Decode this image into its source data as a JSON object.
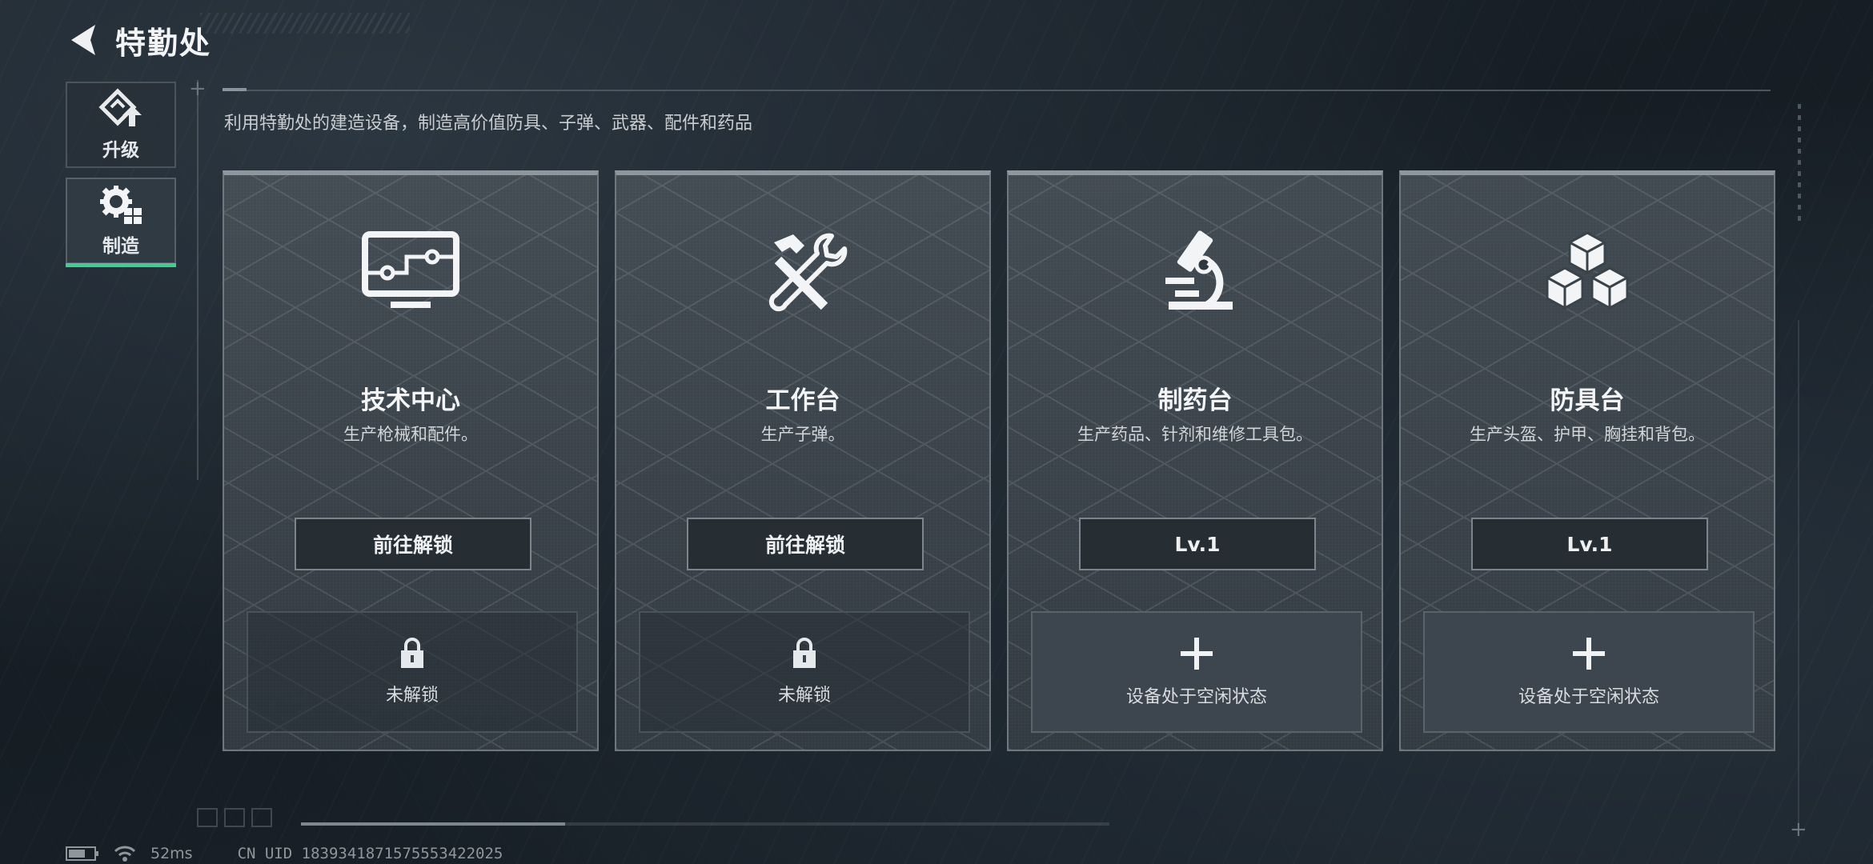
{
  "header": {
    "title": "特勤处"
  },
  "sidebar": {
    "items": [
      {
        "label": "升级",
        "icon": "upgrade-icon",
        "active": false
      },
      {
        "label": "制造",
        "icon": "gear-icon",
        "active": true
      }
    ]
  },
  "main": {
    "description": "利用特勤处的建造设备，制造高价值防具、子弹、武器、配件和药品",
    "cards": [
      {
        "icon": "computer-icon",
        "title": "技术中心",
        "subtitle": "生产枪械和配件。",
        "button_label": "前往解锁",
        "slot_icon": "lock-icon",
        "slot_text": "未解锁"
      },
      {
        "icon": "hammer-wrench-icon",
        "title": "工作台",
        "subtitle": "生产子弹。",
        "button_label": "前往解锁",
        "slot_icon": "lock-icon",
        "slot_text": "未解锁"
      },
      {
        "icon": "microscope-icon",
        "title": "制药台",
        "subtitle": "生产药品、针剂和维修工具包。",
        "button_label": "Lv.1",
        "slot_icon": "plus-icon",
        "slot_text": "设备处于空闲状态"
      },
      {
        "icon": "cubes-icon",
        "title": "防具台",
        "subtitle": "生产头盔、护甲、胸挂和背包。",
        "button_label": "Lv.1",
        "slot_icon": "plus-icon",
        "slot_text": "设备处于空闲状态"
      }
    ]
  },
  "status": {
    "ping": "52ms",
    "uid": "CN UID 1839341871575553422025"
  },
  "colors": {
    "accent": "#3ecf8e",
    "background": "#1b232b",
    "card": "#454e56"
  }
}
